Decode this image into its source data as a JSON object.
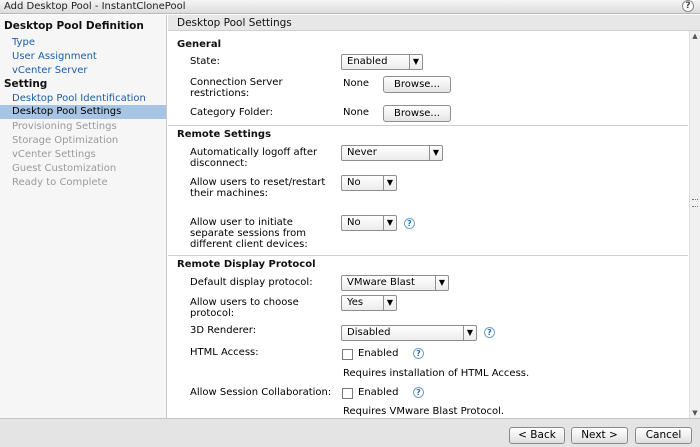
{
  "window": {
    "title": "Add Desktop Pool - InstantClonePool",
    "help": "?"
  },
  "sidebar": {
    "definition_heading": "Desktop Pool Definition",
    "definition_items": [
      "Type",
      "User Assignment",
      "vCenter Server"
    ],
    "setting_heading": "Setting",
    "setting_items": [
      "Desktop Pool Identification",
      "Desktop Pool Settings",
      "Provisioning Settings",
      "Storage Optimization",
      "vCenter Settings",
      "Guest Customization",
      "Ready to Complete"
    ]
  },
  "main": {
    "title": "Desktop Pool Settings",
    "general": {
      "heading": "General",
      "state_label": "State:",
      "state_value": "Enabled",
      "conn_label": "Connection Server restrictions:",
      "conn_value": "None",
      "category_label": "Category Folder:",
      "category_value": "None",
      "browse": "Browse..."
    },
    "remote": {
      "heading": "Remote Settings",
      "logoff_label": "Automatically logoff after disconnect:",
      "logoff_value": "Never",
      "reset_label": "Allow users to reset/restart their machines:",
      "reset_value": "No",
      "sessions_label": "Allow user to initiate separate sessions from different client devices:",
      "sessions_value": "No"
    },
    "display": {
      "heading": "Remote Display Protocol",
      "default_label": "Default display protocol:",
      "default_value": "VMware Blast",
      "choose_label": "Allow users to choose protocol:",
      "choose_value": "Yes",
      "renderer_label": "3D Renderer:",
      "renderer_value": "Disabled",
      "html_label": "HTML Access:",
      "enabled": "Enabled",
      "html_note": "Requires installation of HTML Access.",
      "collab_label": "Allow Session Collaboration:",
      "collab_note": "Requires VMware Blast Protocol."
    }
  },
  "footer": {
    "back": "< Back",
    "next": "Next >",
    "cancel": "Cancel"
  }
}
